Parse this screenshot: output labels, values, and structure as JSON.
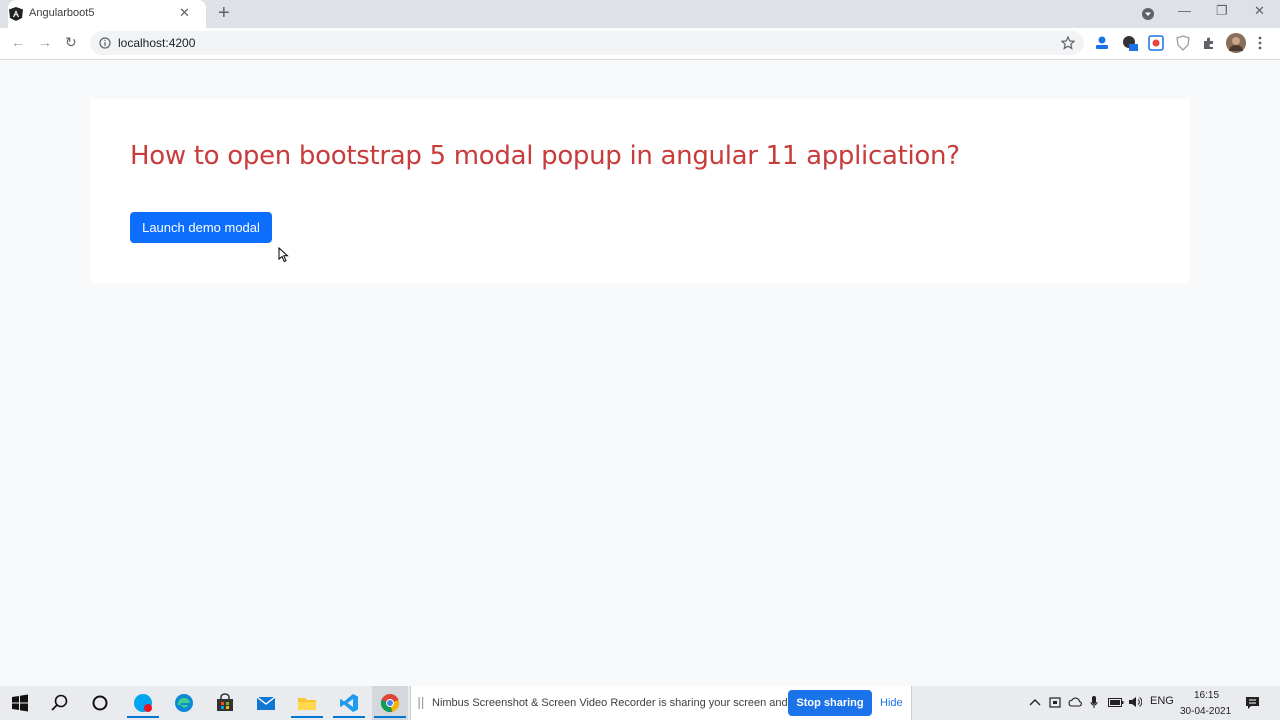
{
  "browser": {
    "tab_title": "Angularboot5",
    "tab_close": "✕",
    "new_tab": "+",
    "url": "localhost:4200",
    "window_controls": {
      "minimize": "—",
      "restore": "❐",
      "close": "✕"
    },
    "nav": {
      "back": "←",
      "forward": "→",
      "reload": "↻"
    }
  },
  "page": {
    "heading": "How to open bootstrap 5 modal popup in angular 11 application?",
    "launch_button": "Launch demo modal"
  },
  "screen_share": {
    "message": "Nimbus Screenshot & Screen Video Recorder is sharing your screen and audio.",
    "stop_button": "Stop sharing",
    "hide_link": "Hide"
  },
  "taskbar": {
    "language": "ENG",
    "time": "16:15",
    "date": "30-04-2021",
    "icons": [
      "windows-start-icon",
      "search-icon",
      "cortana-icon",
      "skype-icon",
      "edge-icon",
      "store-icon",
      "mail-icon",
      "file-explorer-icon",
      "vscode-icon",
      "chrome-icon"
    ]
  },
  "colors": {
    "heading": "#c83c3c",
    "primary_button": "#0d6efd",
    "page_background": "#f8f9fa",
    "share_button": "#1a73e8"
  }
}
